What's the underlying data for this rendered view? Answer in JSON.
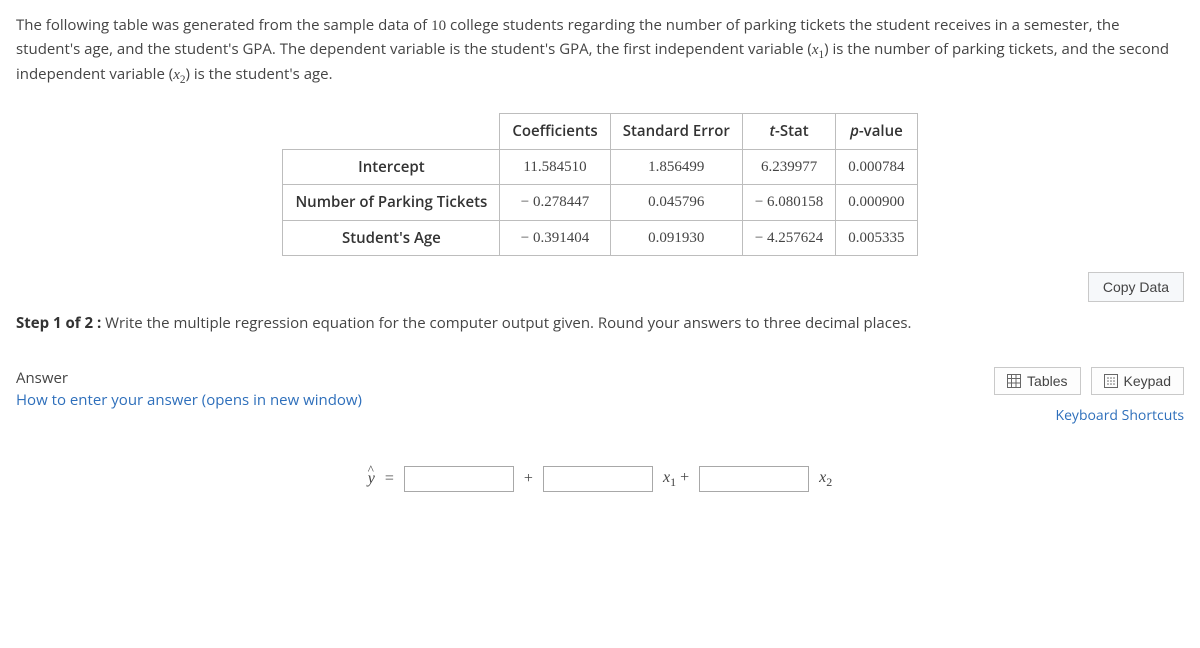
{
  "intro": {
    "text_a": "The following table was generated from the sample data of ",
    "sample_size": "10",
    "text_b": " college students regarding the number of parking tickets the student receives in a semester, the student's age, and the student's GPA. The dependent variable is the student's GPA, the first independent variable (",
    "x1_label": "x",
    "x1_sub": "1",
    "text_c": ") is the number of parking tickets, and the second independent variable (",
    "x2_label": "x",
    "x2_sub": "2",
    "text_d": ") is the student's age."
  },
  "table": {
    "headers": {
      "coef": "Coefficients",
      "se": "Standard Error",
      "tstat_prefix": "t",
      "tstat_suffix": "-Stat",
      "pvalue_prefix": "p",
      "pvalue_suffix": "-value"
    },
    "rows": [
      {
        "label": "Intercept",
        "coef": "11.584510",
        "se": "1.856499",
        "t": "6.239977",
        "p": "0.000784"
      },
      {
        "label": "Number of Parking Tickets",
        "coef": "− 0.278447",
        "se": "0.045796",
        "t": "− 6.080158",
        "p": "0.000900"
      },
      {
        "label": "Student's Age",
        "coef": "− 0.391404",
        "se": "0.091930",
        "t": "− 4.257624",
        "p": "0.005335"
      }
    ]
  },
  "copy_button": "Copy Data",
  "step": {
    "prefix": "Step 1 of 2 :",
    "text": "  Write the multiple regression equation for the computer output given. Round your answers to three decimal places."
  },
  "answer": {
    "label": "Answer",
    "help_link": "How to enter your answer (opens in new window)",
    "tables_btn": "Tables",
    "keypad_btn": "Keypad",
    "kb_shortcuts": "Keyboard Shortcuts"
  },
  "equation": {
    "yhat": "y",
    "hat": "^",
    "eq": " =",
    "plus": "+",
    "x1": "x",
    "x1_sub": "1",
    "plus2": " +",
    "x2": "x",
    "x2_sub": "2"
  },
  "chart_data": {
    "type": "table",
    "title": "Multiple regression output",
    "columns": [
      "",
      "Coefficients",
      "Standard Error",
      "t-Stat",
      "p-value"
    ],
    "rows": [
      [
        "Intercept",
        11.58451,
        1.856499,
        6.239977,
        0.000784
      ],
      [
        "Number of Parking Tickets",
        -0.278447,
        0.045796,
        -6.080158,
        0.0009
      ],
      [
        "Student's Age",
        -0.391404,
        0.09193,
        -4.257624,
        0.005335
      ]
    ],
    "n": 10,
    "dependent_variable": "GPA",
    "independent_variables": [
      "Number of Parking Tickets",
      "Student's Age"
    ]
  }
}
